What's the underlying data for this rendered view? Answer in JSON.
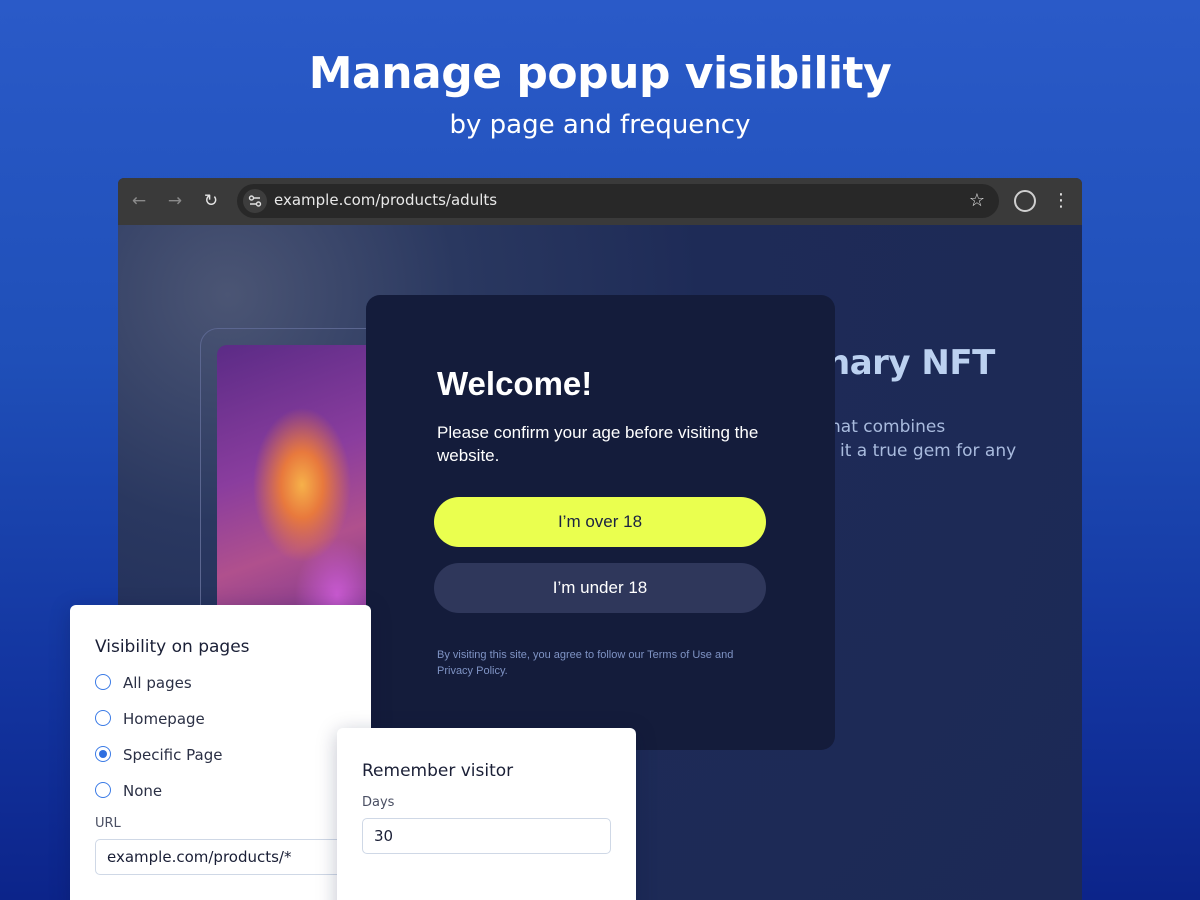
{
  "header": {
    "title": "Manage popup visibility",
    "subtitle": "by page and frequency"
  },
  "browser": {
    "url": "example.com/products/adults",
    "icons": {
      "back": "back-arrow-icon",
      "forward": "forward-arrow-icon",
      "reload": "reload-icon",
      "site_settings": "site-settings-icon",
      "bookmark": "star-icon",
      "profile": "profile-icon",
      "menu": "kebab-menu-icon"
    }
  },
  "page": {
    "heading_partial": "nary NFT",
    "line1_partial": "hat combines",
    "line2_partial": "it a true gem for any"
  },
  "modal": {
    "title": "Welcome!",
    "message": "Please confirm your age before visiting the website.",
    "primary_button": "I’m over 18",
    "secondary_button": "I’m under 18",
    "legal": "By visiting this site, you agree to follow our Terms of Use and Privacy Policy.",
    "colors": {
      "primary_bg": "#eaff4f",
      "secondary_bg": "#2f375b",
      "modal_bg": "#141c3b"
    }
  },
  "visibility_panel": {
    "title": "Visibility on pages",
    "options": [
      {
        "label": "All pages",
        "checked": false
      },
      {
        "label": "Homepage",
        "checked": false
      },
      {
        "label": "Specific Page",
        "checked": true
      },
      {
        "label": "None",
        "checked": false
      }
    ],
    "url_label": "URL",
    "url_value": "example.com/products/*"
  },
  "remember_panel": {
    "title": "Remember visitor",
    "days_label": "Days",
    "days_value": "30"
  }
}
